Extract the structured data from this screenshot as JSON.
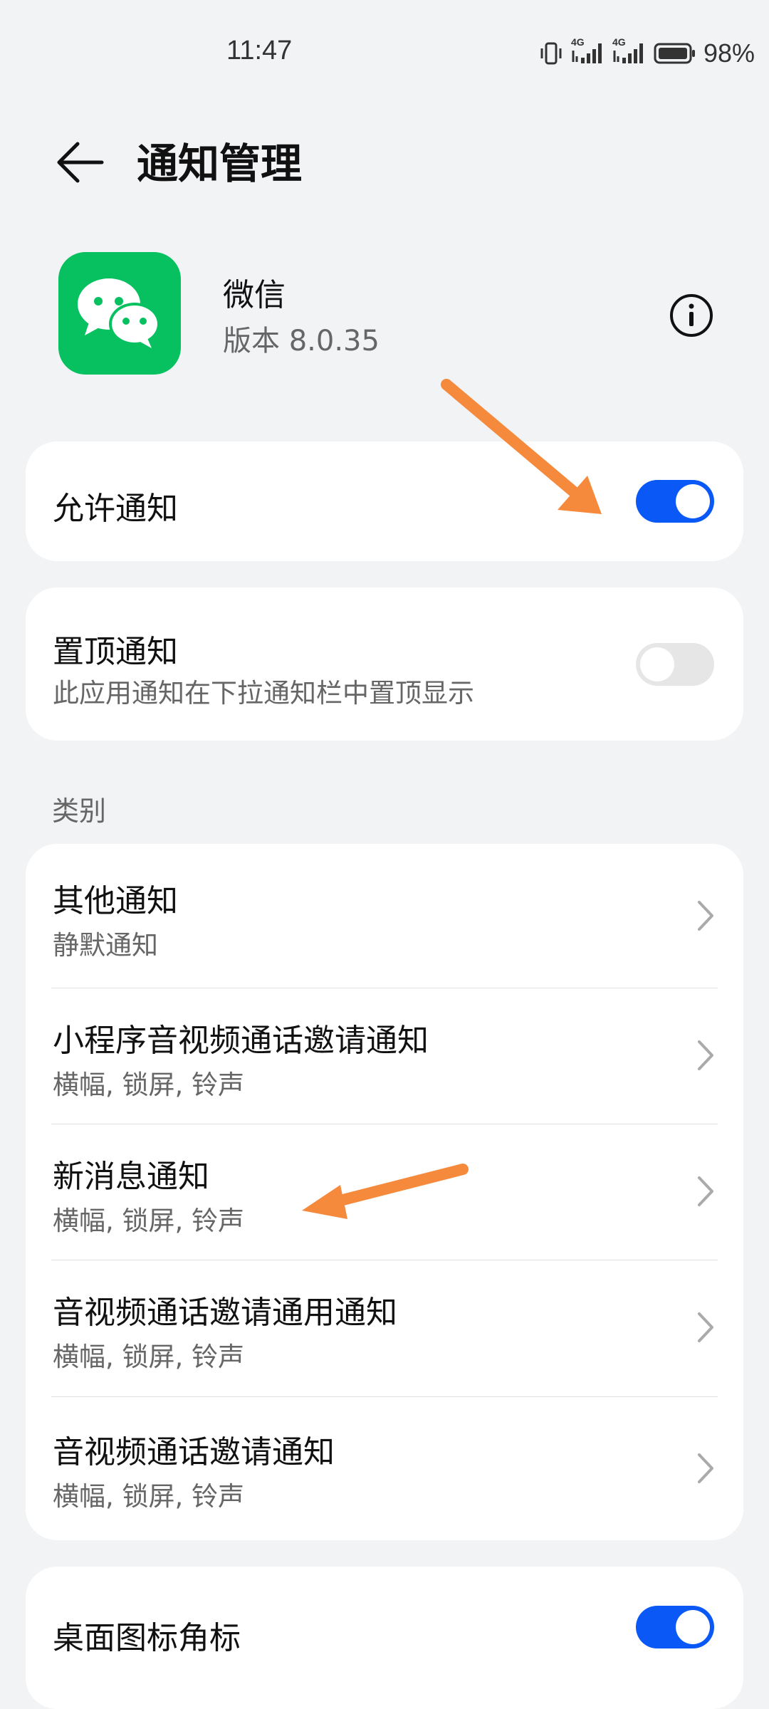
{
  "status_bar": {
    "time": "11:47",
    "battery": "98%",
    "network_1": "4G",
    "network_2": "4G"
  },
  "header": {
    "title": "通知管理"
  },
  "app": {
    "name": "微信",
    "version": "版本 8.0.35"
  },
  "allow_notifications": {
    "label": "允许通知",
    "enabled": true
  },
  "pinned": {
    "title": "置顶通知",
    "subtitle": "此应用通知在下拉通知栏中置顶显示",
    "enabled": false
  },
  "category_section": {
    "label": "类别",
    "items": [
      {
        "title": "其他通知",
        "subtitle": "静默通知"
      },
      {
        "title": "小程序音视频通话邀请通知",
        "subtitle": "横幅, 锁屏, 铃声"
      },
      {
        "title": "新消息通知",
        "subtitle": "横幅, 锁屏, 铃声"
      },
      {
        "title": "音视频通话邀请通用通知",
        "subtitle": "横幅, 锁屏, 铃声"
      },
      {
        "title": "音视频通话邀请通知",
        "subtitle": "横幅, 锁屏, 铃声"
      }
    ]
  },
  "badge": {
    "label": "桌面图标角标",
    "enabled": true
  },
  "colors": {
    "accent": "#0a59f7",
    "wechat_green": "#07c160",
    "annotation_arrow": "#f58a3c",
    "background": "#f1f3f5"
  },
  "icons": {
    "back": "arrow-left-icon",
    "info": "info-icon",
    "chevron": "chevron-right-icon",
    "vibrate": "vibrate-icon",
    "signal": "signal-icon",
    "battery": "battery-icon"
  }
}
